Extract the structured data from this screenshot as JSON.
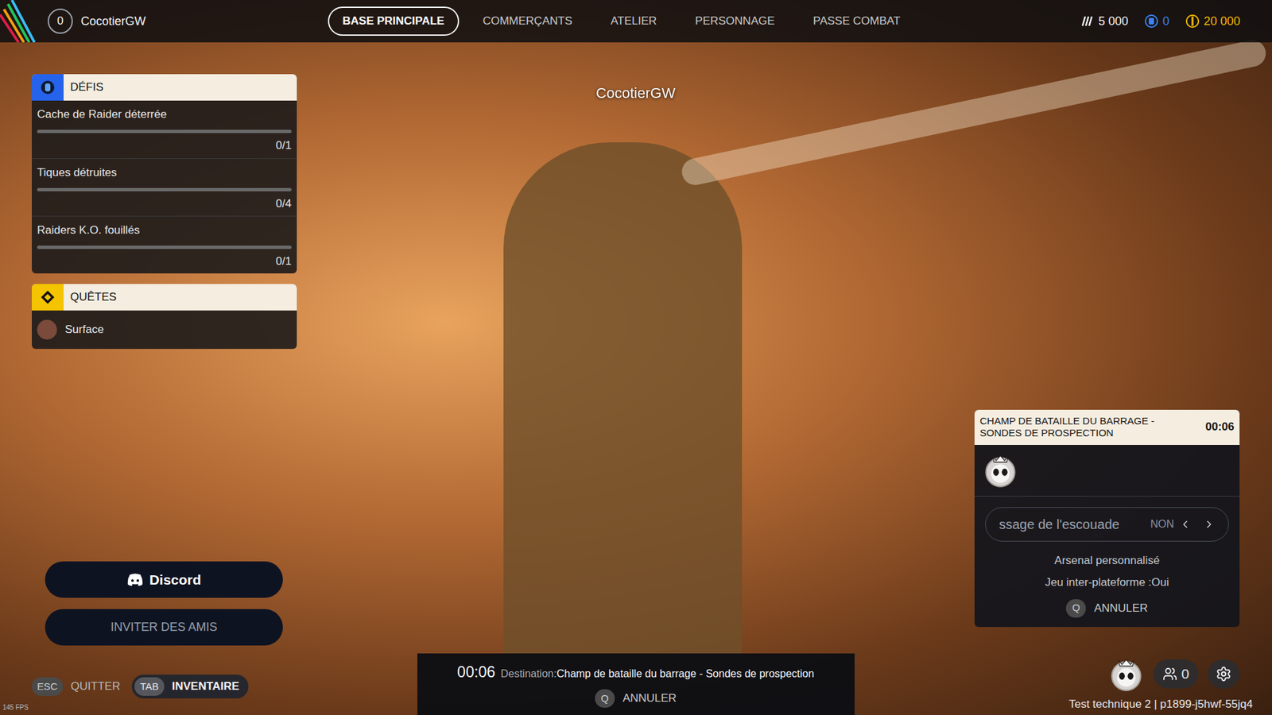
{
  "player": {
    "level": "0",
    "name": "CocotierGW"
  },
  "nav": [
    {
      "label": "BASE PRINCIPALE",
      "selected": true
    },
    {
      "label": "COMMERÇANTS",
      "selected": false
    },
    {
      "label": "ATELIER",
      "selected": false
    },
    {
      "label": "PERSONNAGE",
      "selected": false
    },
    {
      "label": "PASSE COMBAT",
      "selected": false
    }
  ],
  "currencies": [
    {
      "amount": "5 000",
      "color": "#f3f4f6"
    },
    {
      "amount": "0",
      "color": "#3b82f6"
    },
    {
      "amount": "20 000",
      "color": "#f5b800"
    }
  ],
  "character_name": "CocotierGW",
  "challenges": {
    "title": "DÉFIS",
    "items": [
      {
        "label": "Cache de Raider déterrée",
        "progress": "0/1",
        "level": 0
      },
      {
        "label": "Tiques détruites",
        "progress": "0/4",
        "level": 0
      },
      {
        "label": "Raiders K.O. fouillés",
        "progress": "0/1",
        "level": 0
      }
    ]
  },
  "quests": {
    "title": "QUÊTES",
    "items": [
      "Surface"
    ]
  },
  "buttons": {
    "discord": "Discord",
    "invite": "INVITER DES AMIS"
  },
  "keys": [
    {
      "key": "ESC",
      "label": "QUITTER",
      "highlighted": false
    },
    {
      "key": "TAB",
      "label": "INVENTAIRE",
      "highlighted": true
    }
  ],
  "matchmaking": {
    "time": "00:06",
    "destination_label": "Destination:",
    "destination": "Champ de bataille du barrage - Sondes de prospection",
    "cancel_key": "Q",
    "cancel_label": "ANNULER"
  },
  "squad": {
    "title": "CHAMP DE BATAILLE DU BARRAGE - SONDES DE PROSPECTION",
    "time": "00:06",
    "message_placeholder": "ssage de l'escouade",
    "message_toggle": "NON",
    "info": [
      "Arsenal personnalisé",
      "Jeu inter-plateforme :Oui"
    ],
    "cancel_key": "Q",
    "cancel_label": "ANNULER"
  },
  "friends_count": "0",
  "build": "Test technique 2 | p1899-j5hwf-55jq4",
  "fps": "145 FPS"
}
